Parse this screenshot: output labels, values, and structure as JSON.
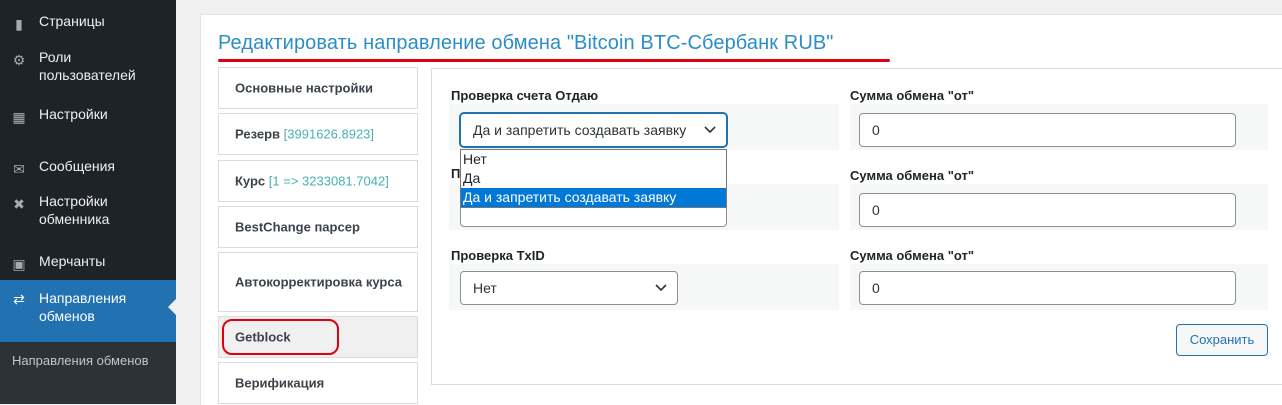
{
  "sidebar": {
    "items": [
      {
        "label": "Страницы",
        "icon": "pages-icon"
      },
      {
        "label": "Роли пользователей",
        "icon": "users-icon"
      },
      {
        "label": "Настройки",
        "icon": "settings-icon"
      },
      {
        "label": "Сообщения",
        "icon": "mail-icon"
      },
      {
        "label": "Настройки обменника",
        "icon": "tools-icon"
      },
      {
        "label": "Мерчанты",
        "icon": "merchants-icon"
      },
      {
        "label": "Направления обменов",
        "icon": "exchange-icon",
        "active": true
      }
    ],
    "submenu": [
      {
        "label": "Направления обменов"
      }
    ],
    "colors": {
      "background": "#1d2327",
      "active": "#2271b1"
    }
  },
  "page": {
    "title": "Редактировать направление обмена \"Bitcoin BTC-Сбербанк RUB\"",
    "title_color": "#2c8ec6"
  },
  "tabs": [
    {
      "label": "Основные настройки",
      "value": ""
    },
    {
      "label": "Резерв",
      "value": "[3991626.8923]"
    },
    {
      "label": "Курс",
      "value": "[1 => 3233081.7042]"
    },
    {
      "label": "BestChange парсер",
      "value": ""
    },
    {
      "label": "Автокорректировка курса",
      "value": ""
    },
    {
      "label": "Getblock",
      "value": "",
      "active": true
    },
    {
      "label": "Верификация",
      "value": ""
    }
  ],
  "form": {
    "rows": [
      {
        "left_label": "Проверка счета Отдаю",
        "left_value": "Да и запретить создавать заявку",
        "right_label": "Сумма обмена \"от\"",
        "right_value": "0"
      },
      {
        "left_label": "П",
        "left_value": "",
        "right_label": "Сумма обмена \"от\"",
        "right_value": "0"
      },
      {
        "left_label": "Проверка TxID",
        "left_value": "Нет",
        "right_label": "Сумма обмена \"от\"",
        "right_value": "0"
      }
    ],
    "dropdown_options": [
      "Нет",
      "Да",
      "Да и запретить создавать заявку"
    ],
    "dropdown_selected": "Да и запретить создавать заявку",
    "save_label": "Сохранить"
  },
  "annotation_color": "#e0000f"
}
